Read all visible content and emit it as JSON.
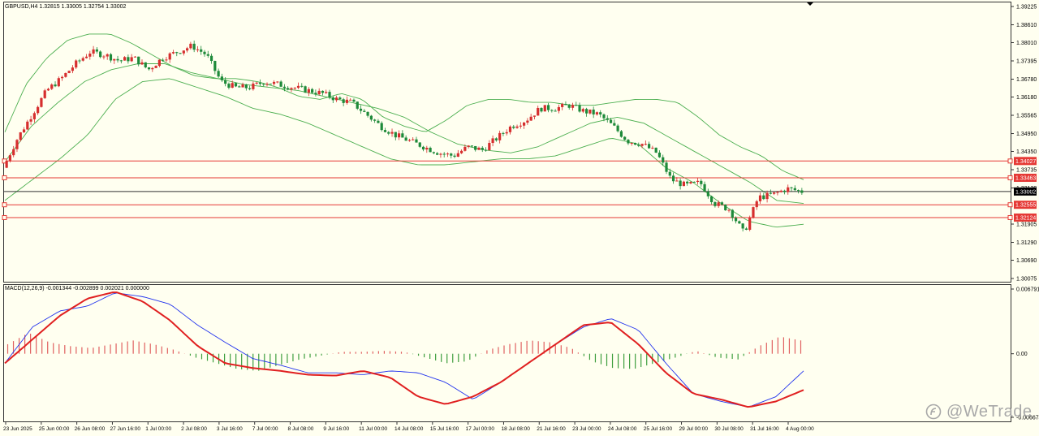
{
  "chart_header": {
    "symbol_line": "GBPUSD,H4  1.32815 1.33005 1.32754 1.33002",
    "macd_line": "MACD(12,26,9) -0.001344 -0.002899 0.002021 0.000000"
  },
  "watermark": {
    "text": "@WeTrade"
  },
  "colors": {
    "background": "#fffff0",
    "bull_candle": "#d62e2e",
    "bear_candle": "#1e8a3a",
    "bollinger": "#4caf50",
    "level_lines": "#e53935",
    "price_line": "#333333",
    "macd_line": "#2233ee",
    "signal_line": "#e02020"
  },
  "chart_data": [
    {
      "type": "candlestick",
      "title": "GBPUSD,H4",
      "ylim": [
        1.30075,
        1.39225
      ],
      "y_ticks": [
        "1.39225",
        "1.38610",
        "1.38010",
        "1.37395",
        "1.36780",
        "1.36180",
        "1.35565",
        "1.34950",
        "1.34350",
        "1.33735",
        "1.33120",
        "1.31905",
        "1.31290",
        "1.30690",
        "1.30075"
      ],
      "x_ticks": [
        "23 Jun 2025",
        "25 Jun 00:00",
        "26 Jun 08:00",
        "27 Jun 16:00",
        "1 Jul 00:00",
        "2 Jul 08:00",
        "3 Jul 16:00",
        "7 Jul 00:00",
        "8 Jul 08:00",
        "9 Jul 16:00",
        "11 Jul 00:00",
        "14 Jul 08:00",
        "15 Jul 16:00",
        "17 Jul 00:00",
        "18 Jul 08:00",
        "21 Jul 16:00",
        "23 Jul 00:00",
        "24 Jul 08:00",
        "25 Jul 16:00",
        "29 Jul 00:00",
        "30 Jul 08:00",
        "31 Jul 16:00",
        "4 Aug 00:00"
      ],
      "current_price": "1.33002",
      "horizontal_levels": [
        "1.34027",
        "1.33463",
        "1.32555",
        "1.32124"
      ],
      "price_path": [
        1.338,
        1.348,
        1.356,
        1.364,
        1.368,
        1.373,
        1.377,
        1.376,
        1.374,
        1.375,
        1.371,
        1.375,
        1.377,
        1.379,
        1.376,
        1.367,
        1.365,
        1.365,
        1.367,
        1.366,
        1.365,
        1.364,
        1.363,
        1.361,
        1.36,
        1.356,
        1.352,
        1.349,
        1.347,
        1.345,
        1.343,
        1.342,
        1.345,
        1.344,
        1.348,
        1.352,
        1.354,
        1.358,
        1.358,
        1.359,
        1.357,
        1.356,
        1.352,
        1.347,
        1.346,
        1.343,
        1.334,
        1.332,
        1.333,
        1.326,
        1.324,
        1.316,
        1.328,
        1.329,
        1.331,
        1.33
      ],
      "bollinger": {
        "upper": [
          1.35,
          1.366,
          1.375,
          1.381,
          1.383,
          1.383,
          1.38,
          1.376,
          1.372,
          1.369,
          1.368,
          1.368,
          1.367,
          1.365,
          1.362,
          1.361,
          1.363,
          1.361,
          1.355,
          1.352,
          1.35,
          1.354,
          1.359,
          1.361,
          1.361,
          1.36,
          1.36,
          1.359,
          1.359,
          1.36,
          1.361,
          1.361,
          1.36,
          1.355,
          1.349,
          1.345,
          1.342,
          1.337,
          1.334
        ],
        "middle": [
          1.34,
          1.352,
          1.36,
          1.367,
          1.371,
          1.373,
          1.373,
          1.37,
          1.368,
          1.366,
          1.365,
          1.364,
          1.362,
          1.36,
          1.358,
          1.355,
          1.35,
          1.346,
          1.344,
          1.343,
          1.345,
          1.349,
          1.353,
          1.355,
          1.353,
          1.348,
          1.343,
          1.338,
          1.333,
          1.327,
          1.326
        ],
        "lower": [
          1.327,
          1.334,
          1.341,
          1.349,
          1.361,
          1.367,
          1.368,
          1.365,
          1.362,
          1.358,
          1.356,
          1.353,
          1.349,
          1.345,
          1.341,
          1.339,
          1.339,
          1.34,
          1.341,
          1.341,
          1.342,
          1.345,
          1.348,
          1.346,
          1.338,
          1.333,
          1.326,
          1.32,
          1.318,
          1.319
        ]
      }
    },
    {
      "type": "line",
      "title": "MACD(12,26,9)",
      "ylim": [
        -0.006674,
        0.006791
      ],
      "y_ticks": [
        "0.006791",
        "0.00",
        "-0.006674"
      ],
      "series": [
        {
          "name": "MACD",
          "values": [
            -0.001,
            0.0028,
            0.0045,
            0.005,
            0.0064,
            0.006,
            0.0052,
            0.003,
            0.0012,
            -0.0005,
            -0.0012,
            -0.002,
            -0.002,
            -0.0022,
            -0.0018,
            -0.002,
            -0.003,
            -0.0048,
            -0.003,
            -0.001,
            0.001,
            0.0028,
            0.0037,
            0.0025,
            -0.001,
            -0.0042,
            -0.005,
            -0.0056,
            -0.0045,
            -0.0018
          ]
        },
        {
          "name": "Signal",
          "values": [
            -0.001,
            0.0015,
            0.004,
            0.0058,
            0.0065,
            0.0055,
            0.0035,
            0.0008,
            -0.001,
            -0.0015,
            -0.0018,
            -0.0022,
            -0.0023,
            -0.0018,
            -0.0025,
            -0.0045,
            -0.0053,
            -0.0045,
            -0.003,
            -0.001,
            0.001,
            0.003,
            0.0033,
            0.001,
            -0.002,
            -0.0042,
            -0.0048,
            -0.0056,
            -0.005,
            -0.0038
          ]
        }
      ],
      "histogram": [
        0.001,
        0.0022,
        0.0012,
        0.0008,
        0.0006,
        0.001,
        0.0014,
        0.001,
        0.0004,
        -0.0004,
        -0.001,
        -0.0016,
        -0.0018,
        -0.0012,
        -0.0006,
        -0.0002,
        0.0002,
        0.0002,
        0.0003,
        0.0002,
        -0.0004,
        -0.001,
        -0.0008,
        0.0004,
        0.001,
        0.0014,
        0.0012,
        0.0006,
        -0.0008,
        -0.0015,
        -0.0016,
        -0.001,
        -0.0004,
        0.0003,
        -0.0004,
        -0.0006,
        0.0008,
        0.0018,
        0.0014
      ]
    }
  ]
}
